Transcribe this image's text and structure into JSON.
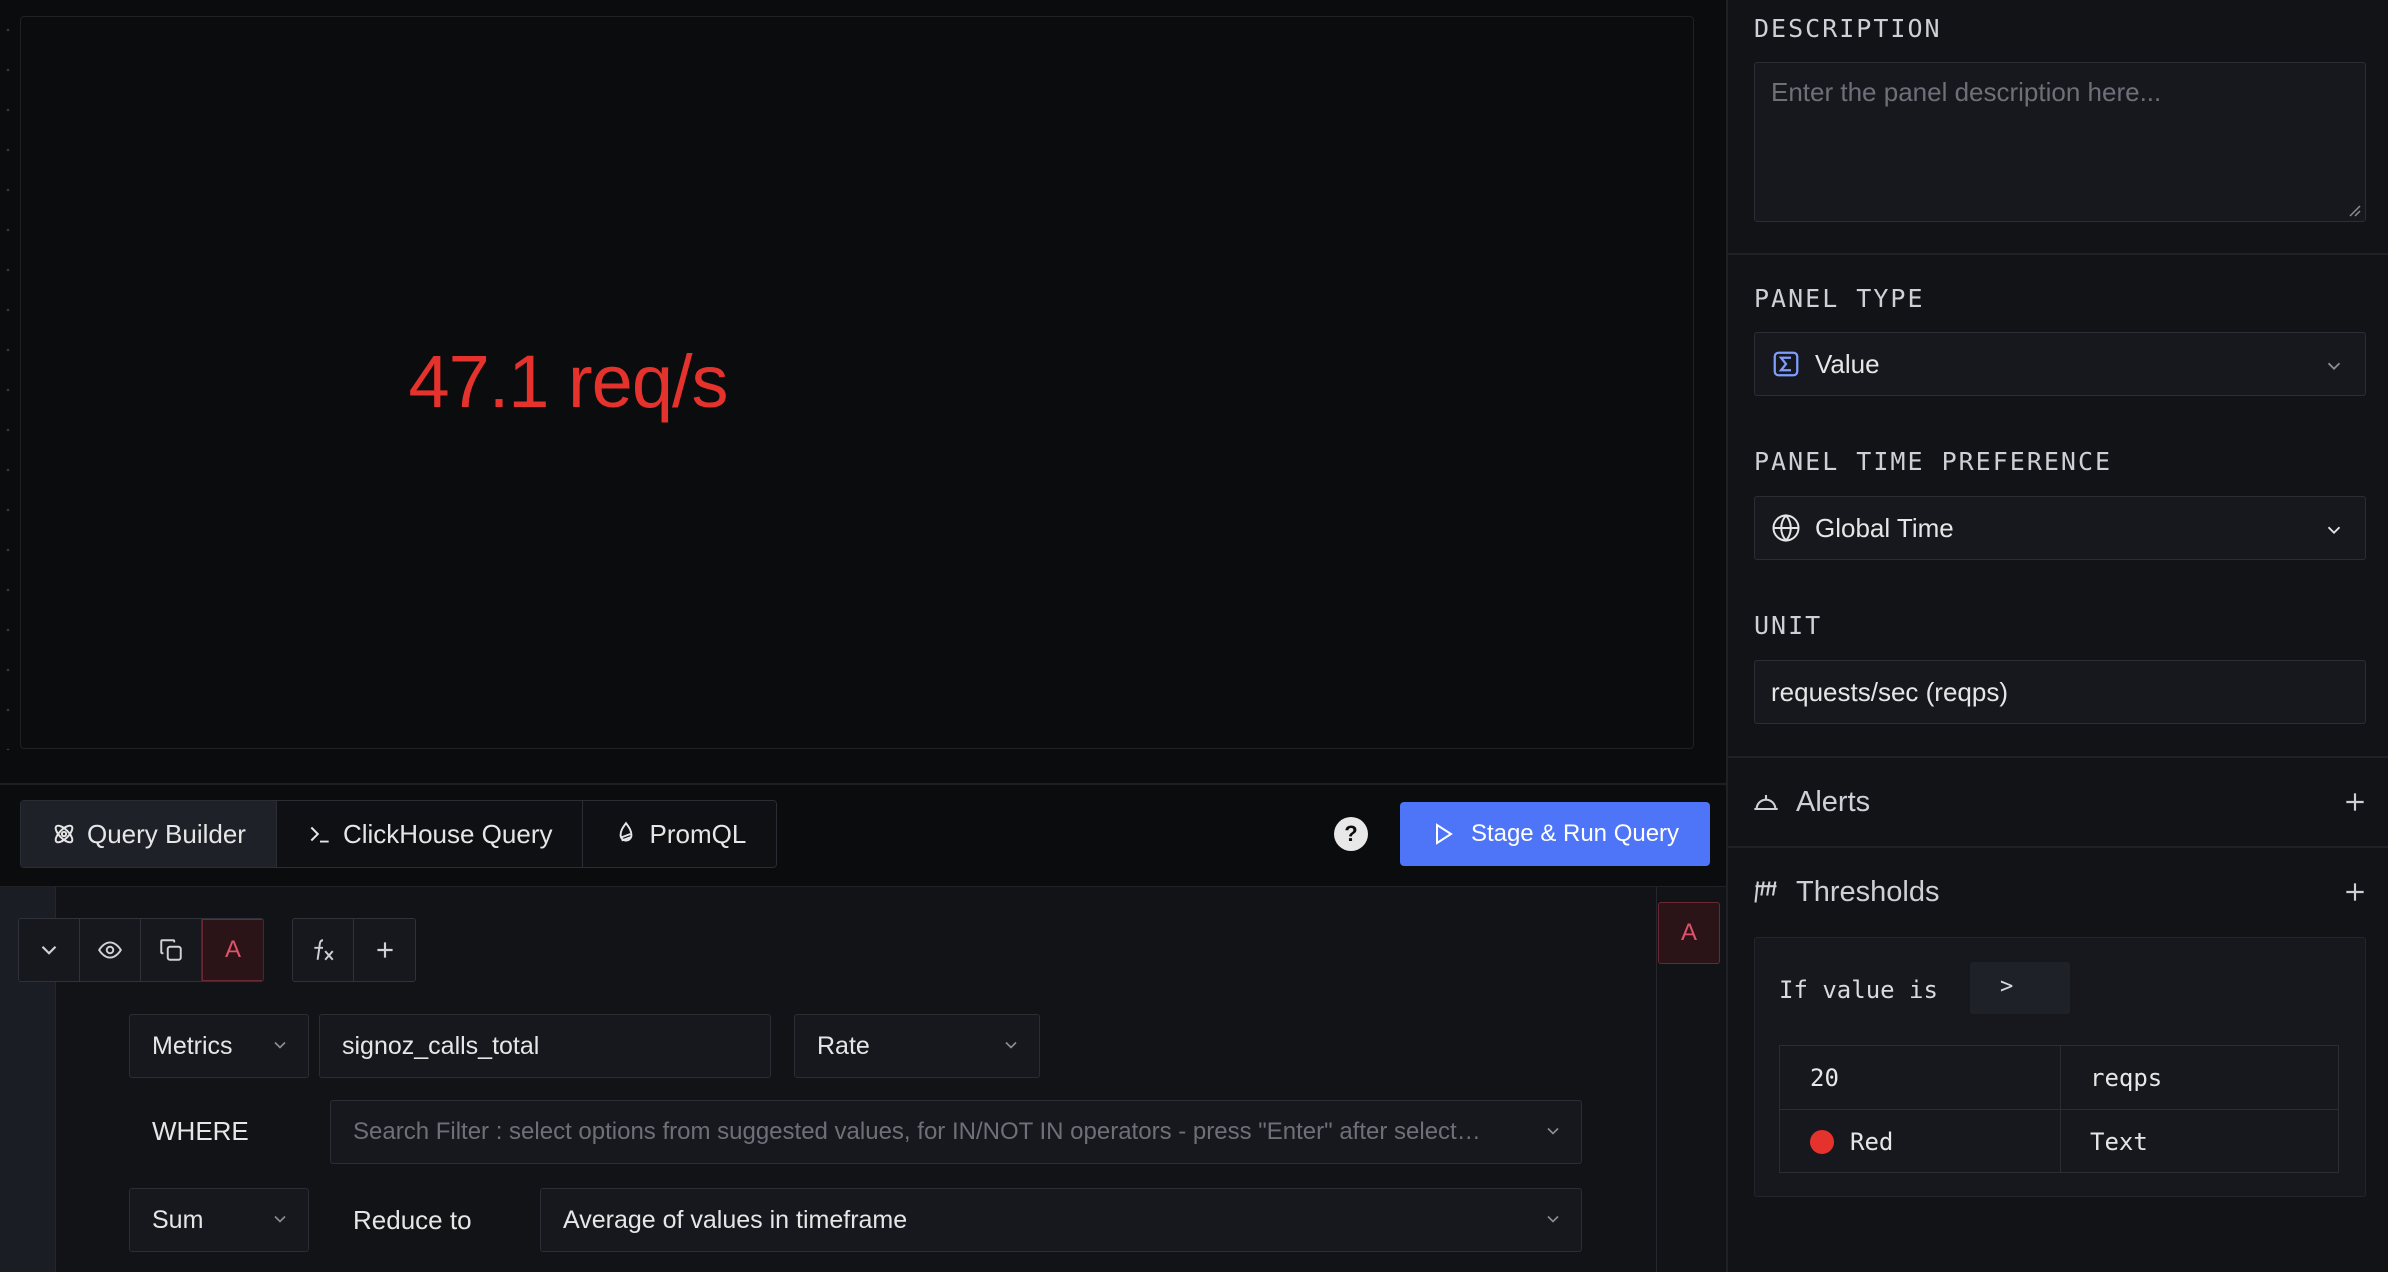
{
  "preview": {
    "value": "47.1 req/s"
  },
  "query_tabs": [
    {
      "label": "Query Builder",
      "icon": "query-builder-icon",
      "active": true
    },
    {
      "label": "ClickHouse Query",
      "icon": "terminal-icon",
      "active": false
    },
    {
      "label": "PromQL",
      "icon": "promql-icon",
      "active": false
    }
  ],
  "help": "?",
  "run_button": "Stage & Run Query",
  "query": {
    "name": "A",
    "data_source": "Metrics",
    "metric": "signoz_calls_total",
    "aggregate_operator": "Rate",
    "where_label": "WHERE",
    "filter_placeholder": "Search Filter : select options from suggested values, for IN/NOT IN operators - press \"Enter\" after select…",
    "space_aggregation": "Sum",
    "reduce_label": "Reduce to",
    "reduce_value": "Average of values in timeframe"
  },
  "right_badge": "A",
  "panel": {
    "description_label": "DESCRIPTION",
    "description_placeholder": "Enter the panel description here...",
    "type_label": "PANEL TYPE",
    "type_value": "Value",
    "time_label": "PANEL TIME PREFERENCE",
    "time_value": "Global Time",
    "unit_label": "UNIT",
    "unit_value": "requests/sec (reqps)",
    "alerts_label": "Alerts",
    "thresholds_label": "Thresholds"
  },
  "threshold": {
    "if_label": "If value is",
    "operator": ">",
    "value": "20",
    "unit": "reqps",
    "color": "Red",
    "color_hex": "#e5322d",
    "format": "Text"
  },
  "colors": {
    "accent": "#4e74f8",
    "value_red": "#e5322d",
    "query_pink": "#e0526a"
  }
}
